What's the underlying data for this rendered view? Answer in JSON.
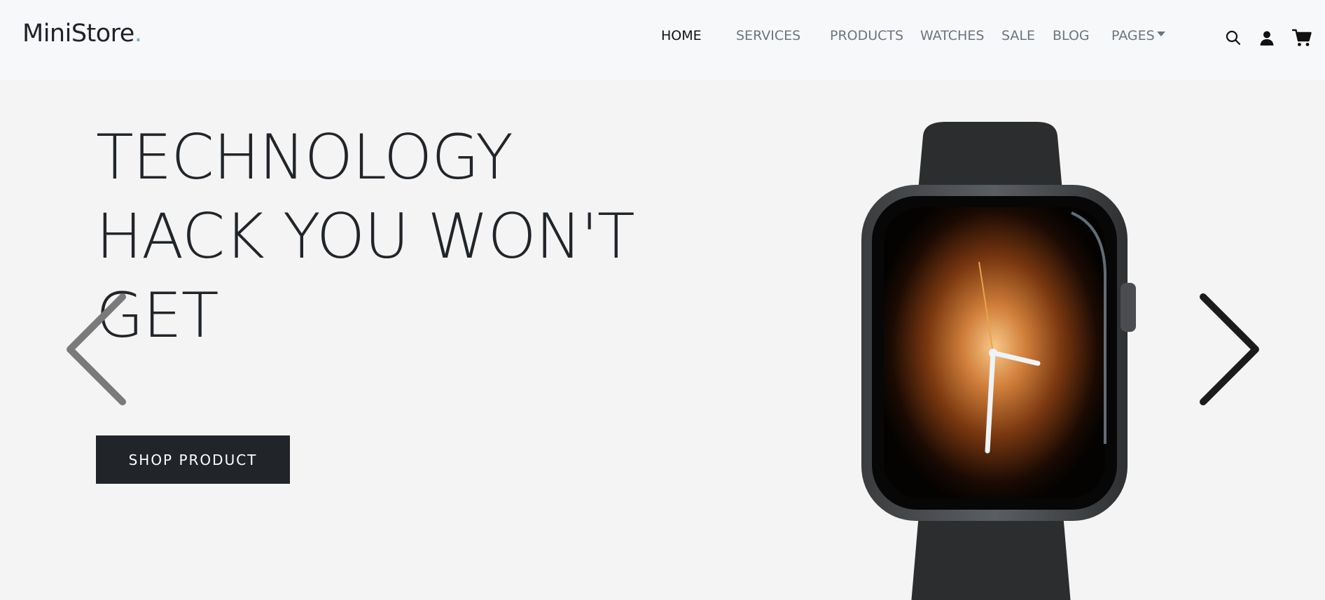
{
  "brand": {
    "name": "MiniStore",
    "dot": "."
  },
  "nav": {
    "items": [
      {
        "label": "HOME",
        "active": true
      },
      {
        "label": "SERVICES",
        "active": false
      },
      {
        "label": "PRODUCTS",
        "active": false
      },
      {
        "label": "WATCHES",
        "active": false
      },
      {
        "label": "SALE",
        "active": false
      },
      {
        "label": "BLOG",
        "active": false
      },
      {
        "label": "PAGES",
        "active": false,
        "dropdown": true
      }
    ]
  },
  "header_icons": [
    "search-icon",
    "user-icon",
    "cart-icon"
  ],
  "hero": {
    "headline_lines": [
      "TECHNOLOGY",
      "HACK YOU WON'T",
      "GET"
    ],
    "cta_label": "SHOP PRODUCT",
    "prev_icon": "chevron-left-icon",
    "next_icon": "chevron-right-icon",
    "image": "smart-watch-product-image"
  },
  "colors": {
    "header_bg": "#f7f8fa",
    "hero_bg": "#f4f4f4",
    "text_dark": "#212529",
    "nav_muted": "#6c757d",
    "brand_dot": "#72aec8",
    "button_bg": "#212529",
    "button_text": "#ffffff"
  }
}
